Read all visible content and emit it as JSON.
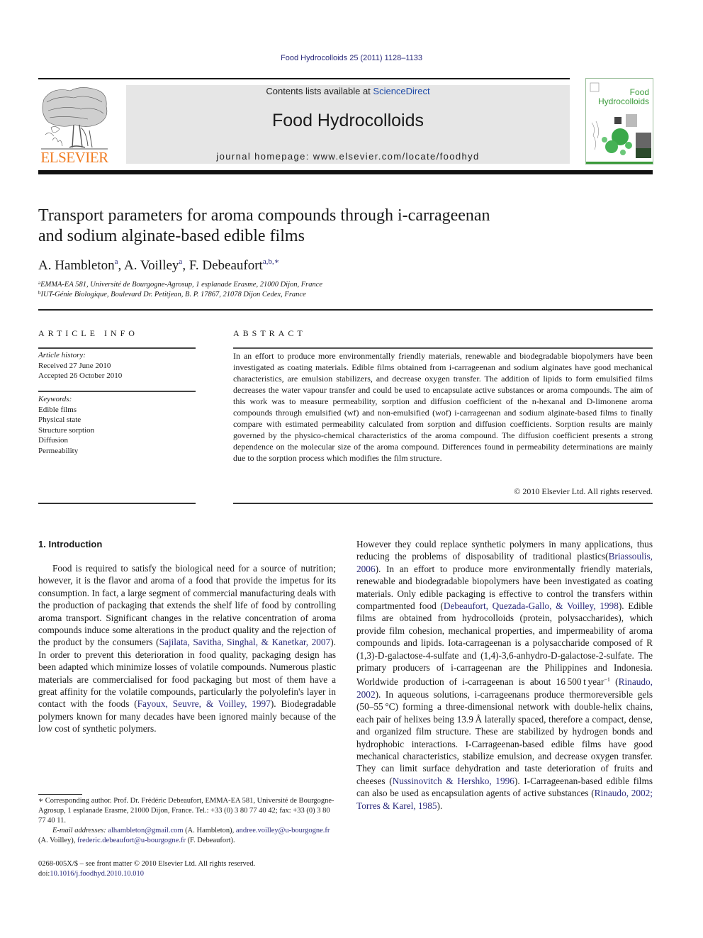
{
  "running_header": {
    "journal_ref": "Food Hydrocolloids 25 (2011) 1128–1133"
  },
  "masthead": {
    "publisher_logo_text": "ELSEVIER",
    "contents_prefix": "Contents lists available at ",
    "contents_link": "ScienceDirect",
    "journal_title": "Food Hydrocolloids",
    "homepage": "journal homepage: www.elsevier.com/locate/foodhyd",
    "cover_title_line1": "Food",
    "cover_title_line2": "Hydrocolloids",
    "colors": {
      "elsevier_orange": "#f07c22",
      "sciencedirect_blue": "#1f4ba8",
      "cover_green": "#3a9a3a",
      "link_navy": "#2a2a7a",
      "masthead_gray": "#e6e6e6"
    }
  },
  "article": {
    "title_line1": "Transport parameters for aroma compounds through i-carrageenan",
    "title_line2": "and sodium alginate-based edible films",
    "authors": [
      {
        "name": "A. Hambleton",
        "sup": "a",
        "sep": ", "
      },
      {
        "name": "A. Voilley",
        "sup": "a",
        "sep": ", "
      },
      {
        "name": "F. Debeaufort",
        "sup": "a,b,∗",
        "sep": ""
      }
    ],
    "affiliations": [
      {
        "mark": "a",
        "text": "EMMA-EA 581, Université de Bourgogne-Agrosup, 1 esplanade Erasme, 21000 Dijon, France"
      },
      {
        "mark": "b",
        "text": "IUT-Génie Biologique, Boulevard Dr. Petitjean, B. P. 17867, 21078 Dijon Cedex, France"
      }
    ]
  },
  "article_info": {
    "heading": "ARTICLE INFO",
    "history_label": "Article history:",
    "received": "Received 27 June 2010",
    "accepted": "Accepted 26 October 2010",
    "keywords_label": "Keywords:",
    "keywords": [
      "Edible films",
      "Physical state",
      "Structure sorption",
      "Diffusion",
      "Permeability"
    ]
  },
  "abstract": {
    "heading": "ABSTRACT",
    "text": "In an effort to produce more environmentally friendly materials, renewable and biodegradable biopolymers have been investigated as coating materials. Edible films obtained from i-carrageenan and sodium alginates have good mechanical characteristics, are emulsion stabilizers, and decrease oxygen transfer. The addition of lipids to form emulsified films decreases the water vapour transfer and could be used to encapsulate active substances or aroma compounds. The aim of this work was to measure permeability, sorption and diffusion coefficient of the n-hexanal and D-limonene aroma compounds through emulsified (wf) and non-emulsified (wof) i-carrageenan and sodium alginate-based films to finally compare with estimated permeability calculated from sorption and diffusion coefficients. Sorption results are mainly governed by the physico-chemical characteristics of the aroma compound. The diffusion coefficient presents a strong dependence on the molecular size of the aroma compound. Differences found in permeability determinations are mainly due to the sorption process which modifies the film structure.",
    "copyright": "© 2010 Elsevier Ltd. All rights reserved."
  },
  "body": {
    "section_heading": "1.  Introduction",
    "left_column": [
      {
        "t": "Food is required to satisfy the biological need for a source of nutrition; however, it is the flavor and aroma of a food that provide the impetus for its consumption. In fact, a large segment of commercial manufacturing deals with the production of packaging that extends the shelf life of food by controlling aroma transport. Significant changes in the relative concentration of aroma compounds induce some alterations in the product quality and the rejection of the product by the consumers ("
      },
      {
        "link": "Sajilata, Savitha, Singhal, & Kanetkar, 2007"
      },
      {
        "t": "). In order to prevent this deterioration in food quality, packaging design has been adapted which minimize losses of volatile compounds. Numerous plastic materials are commercialised for food packaging but most of them have a great affinity for the volatile compounds, particularly the polyolefin's layer in contact with the foods ("
      },
      {
        "link": "Fayoux, Seuvre, & Voilley, 1997"
      },
      {
        "t": "). Biodegradable polymers known for many decades have been ignored mainly because of the low cost of synthetic polymers."
      }
    ],
    "right_column": [
      {
        "t": "However they could replace synthetic polymers in many applications, thus reducing the problems of disposability of traditional plastics("
      },
      {
        "link": "Briassoulis, 2006"
      },
      {
        "t": "). In an effort to produce more environmentally friendly materials, renewable and biodegradable biopolymers have been investigated as coating materials. Only edible packaging is effective to control the transfers within compartmented food ("
      },
      {
        "link": "Debeaufort, Quezada-Gallo, & Voilley, 1998"
      },
      {
        "t": "). Edible films are obtained from hydrocolloids (protein, polysaccharides), which provide film cohesion, mechanical properties, and impermeability of aroma compounds and lipids. Iota-carrageenan is a polysaccharide composed of R (1,3)-D-galactose-4-sulfate and (1,4)-3,6-anhydro-D-galactose-2-sulfate. The primary producers of i-carrageenan are the Philippines and Indonesia. Worldwide production of i-carrageenan is about 16 500 t year"
      },
      {
        "sup": "−1"
      },
      {
        "t": " ("
      },
      {
        "link": "Rinaudo, 2002"
      },
      {
        "t": "). In aqueous solutions, i-carrageenans produce thermoreversible gels (50–55 °C) forming a three-dimensional network with double-helix chains, each pair of helixes being 13.9 Å laterally spaced, therefore a compact, dense, and organized film structure. These are stabilized by hydrogen bonds and hydrophobic interactions. I-Carrageenan-based edible films have good mechanical characteristics, stabilize emulsion, and decrease oxygen transfer. They can limit surface dehydration and taste deterioration of fruits and cheeses ("
      },
      {
        "link": "Nussinovitch & Hershko, 1996"
      },
      {
        "t": "). I-Carrageenan-based edible films can also be used as encapsulation agents of active substances ("
      },
      {
        "link": "Rinaudo, 2002; Torres & Karel, 1985"
      },
      {
        "t": ")."
      }
    ]
  },
  "footnotes": {
    "corresponding": "∗ Corresponding author. Prof. Dr. Frédéric Debeaufort, EMMA-EA 581, Université de Bourgogne-Agrosup, 1 esplanade Erasme, 21000 Dijon, France. Tel.: +33 (0) 3 80 77 40 42; fax: +33 (0) 3 80 77 40 11.",
    "email_label": "E-mail addresses: ",
    "emails": [
      {
        "address": "alhambleton@gmail.com",
        "owner": " (A. Hambleton), "
      },
      {
        "address": "andree.voilley@u-bourgogne.fr",
        "owner": " (A. Voilley), "
      },
      {
        "address": "frederic.debeaufort@u-bourgogne.fr",
        "owner": " (F. Debeaufort)."
      }
    ],
    "issn_line": "0268-005X/$ – see front matter © 2010 Elsevier Ltd. All rights reserved.",
    "doi_prefix": "doi:",
    "doi": "10.1016/j.foodhyd.2010.10.010"
  }
}
